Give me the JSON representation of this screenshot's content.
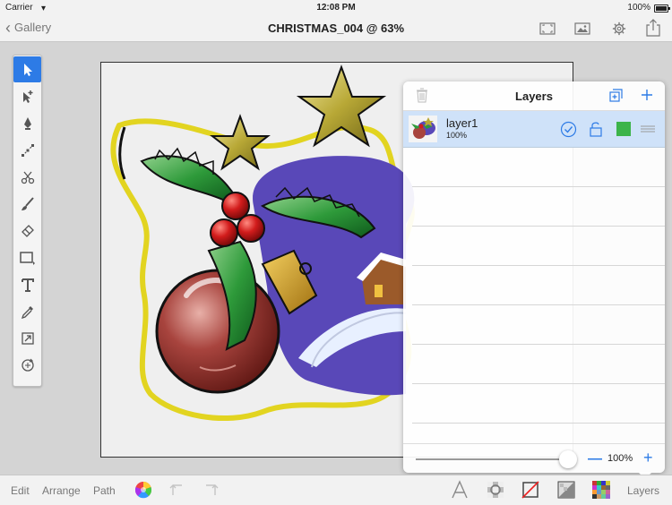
{
  "status_bar": {
    "carrier": "Carrier",
    "time": "12:08 PM",
    "battery": "100%"
  },
  "nav": {
    "back_label": "Gallery",
    "title": "CHRISTMAS_004 @ 63%"
  },
  "tools": [
    "select",
    "direct-select",
    "pen",
    "node-edit",
    "scissors",
    "brush",
    "eraser",
    "shape",
    "text",
    "eyedropper",
    "transform",
    "pivot"
  ],
  "layers_panel": {
    "title": "Layers",
    "layers": [
      {
        "name": "layer1",
        "opacity": "100%",
        "visible": true,
        "locked": false,
        "color": "#3cb44a"
      }
    ],
    "zoom": "100%",
    "zoom_level": 1.0
  },
  "bottom_toolbar": {
    "edit": "Edit",
    "arrange": "Arrange",
    "path": "Path",
    "layers": "Layers"
  },
  "colors": {
    "accent": "#2d7be6",
    "selected_row": "#cfe2f9"
  }
}
